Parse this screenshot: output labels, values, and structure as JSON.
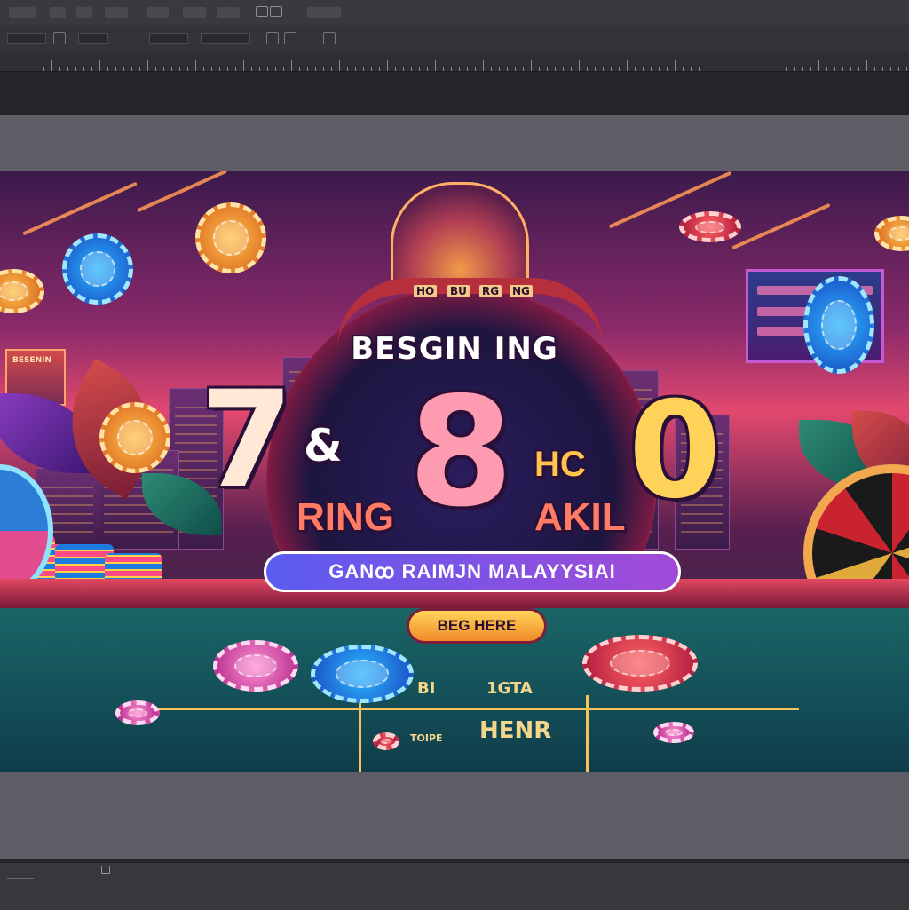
{
  "app": {
    "menu": [
      "",
      "",
      "",
      "",
      "",
      "",
      ""
    ],
    "options": [
      "",
      "",
      "",
      ""
    ],
    "ruler_labels": [],
    "status_zoom": ""
  },
  "artwork": {
    "headline": "BESGIN ING",
    "num_left": "7",
    "amp": "&",
    "num_mid": "8",
    "num_right": "0",
    "word_ring": "RING",
    "word_hc": "HC",
    "word_akil": "AKIL",
    "banner": "GANꝏ RAIMJN MALAYYSIAI",
    "cta": "BEG HERE",
    "left_sign": "BESENIN",
    "wheel_labels": [
      "HO",
      "BU",
      "RG",
      "NG"
    ],
    "felt_texts": [
      "TOIPE",
      "HENR",
      "1GTA",
      "BI"
    ]
  },
  "colors": {
    "accent_pink": "#ff9bb0",
    "accent_gold": "#ffd25a",
    "banner_purple": "#5b5cf0",
    "cta_orange": "#f08a2a"
  }
}
